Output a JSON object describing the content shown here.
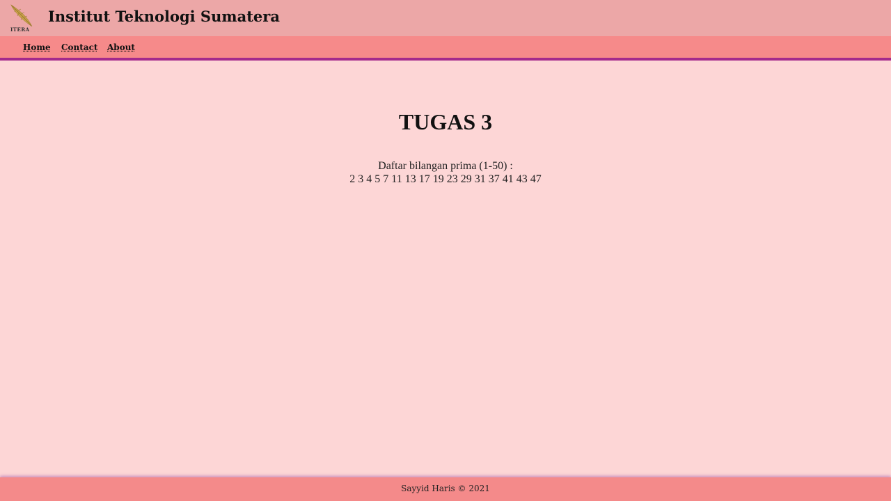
{
  "header": {
    "logo_text": "ITERA",
    "site_title": "Institut Teknologi Sumatera"
  },
  "nav": {
    "items": [
      {
        "label": "Home"
      },
      {
        "label": "Contact"
      },
      {
        "label": "About"
      }
    ]
  },
  "main": {
    "heading": "TUGAS 3",
    "primes_label": "Daftar bilangan prima (1-50) :",
    "primes_list": "2 3 4 5 7 11 13 17 19 23 29 31 37 41 43 47"
  },
  "footer": {
    "text": "Sayyid Haris © 2021"
  },
  "colors": {
    "header_bg": "#eca7a7",
    "nav_bg": "#f68a8a",
    "nav_border": "#a42a8c",
    "page_bg": "#fdd6d6",
    "footer_bg": "#f48a8a",
    "logo_leaf": "#c9a24a"
  }
}
